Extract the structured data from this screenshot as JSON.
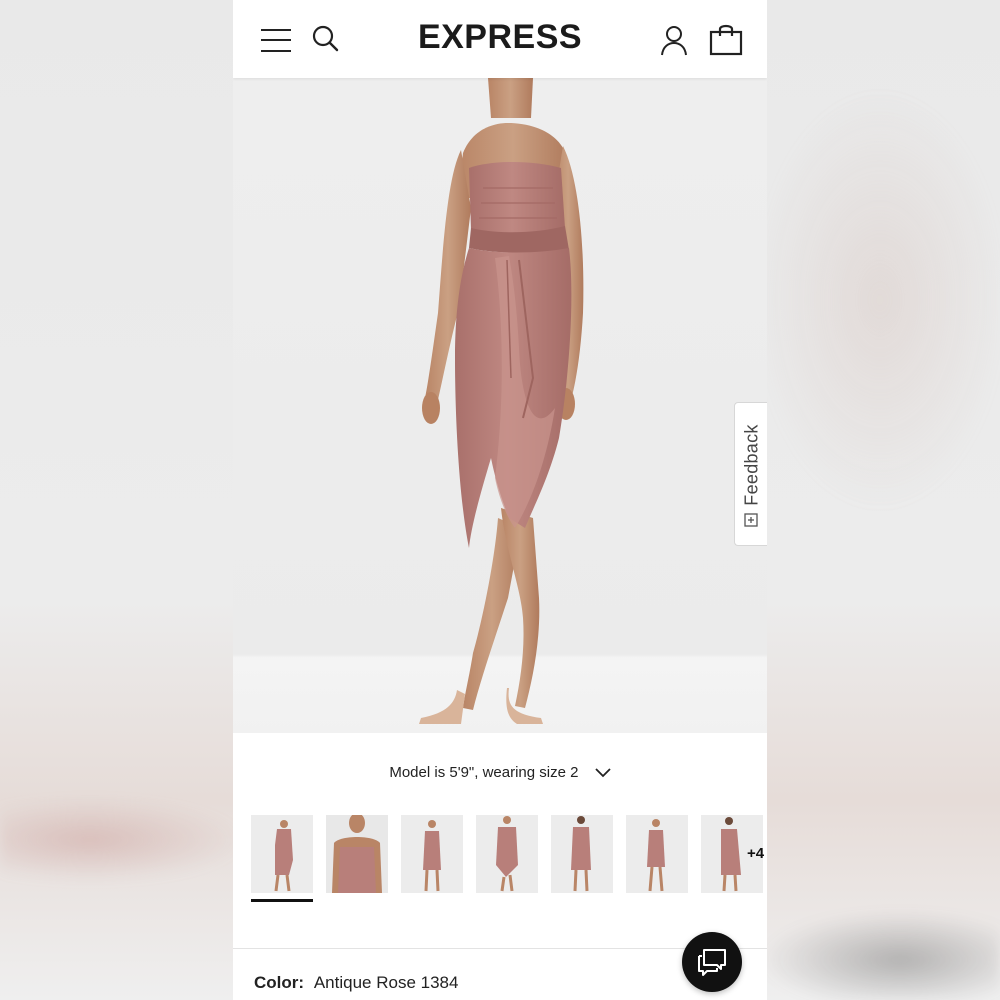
{
  "header": {
    "brand": "EXPRESS",
    "icons": [
      "menu-icon",
      "search-icon",
      "account-icon",
      "shopping-bag-icon"
    ]
  },
  "product": {
    "image_alt": "Model wearing strapless draped midi dress",
    "model_info": "Model is 5'9\", wearing size 2",
    "thumbnail_count_visible": 7,
    "thumbnail_more": "+4",
    "active_thumbnail_index": 0,
    "color_label": "Color:",
    "color_value": "Antique Rose 1384",
    "dress_color": "#b87f7a"
  },
  "feedback": {
    "label": "Feedback",
    "icon": "feedback-icon"
  },
  "chat": {
    "icon": "chat-icon"
  },
  "colors": {
    "header_bg": "#ffffff",
    "hero_bg": "#eeeeee",
    "text": "#222222",
    "chat_bg": "#111111"
  }
}
